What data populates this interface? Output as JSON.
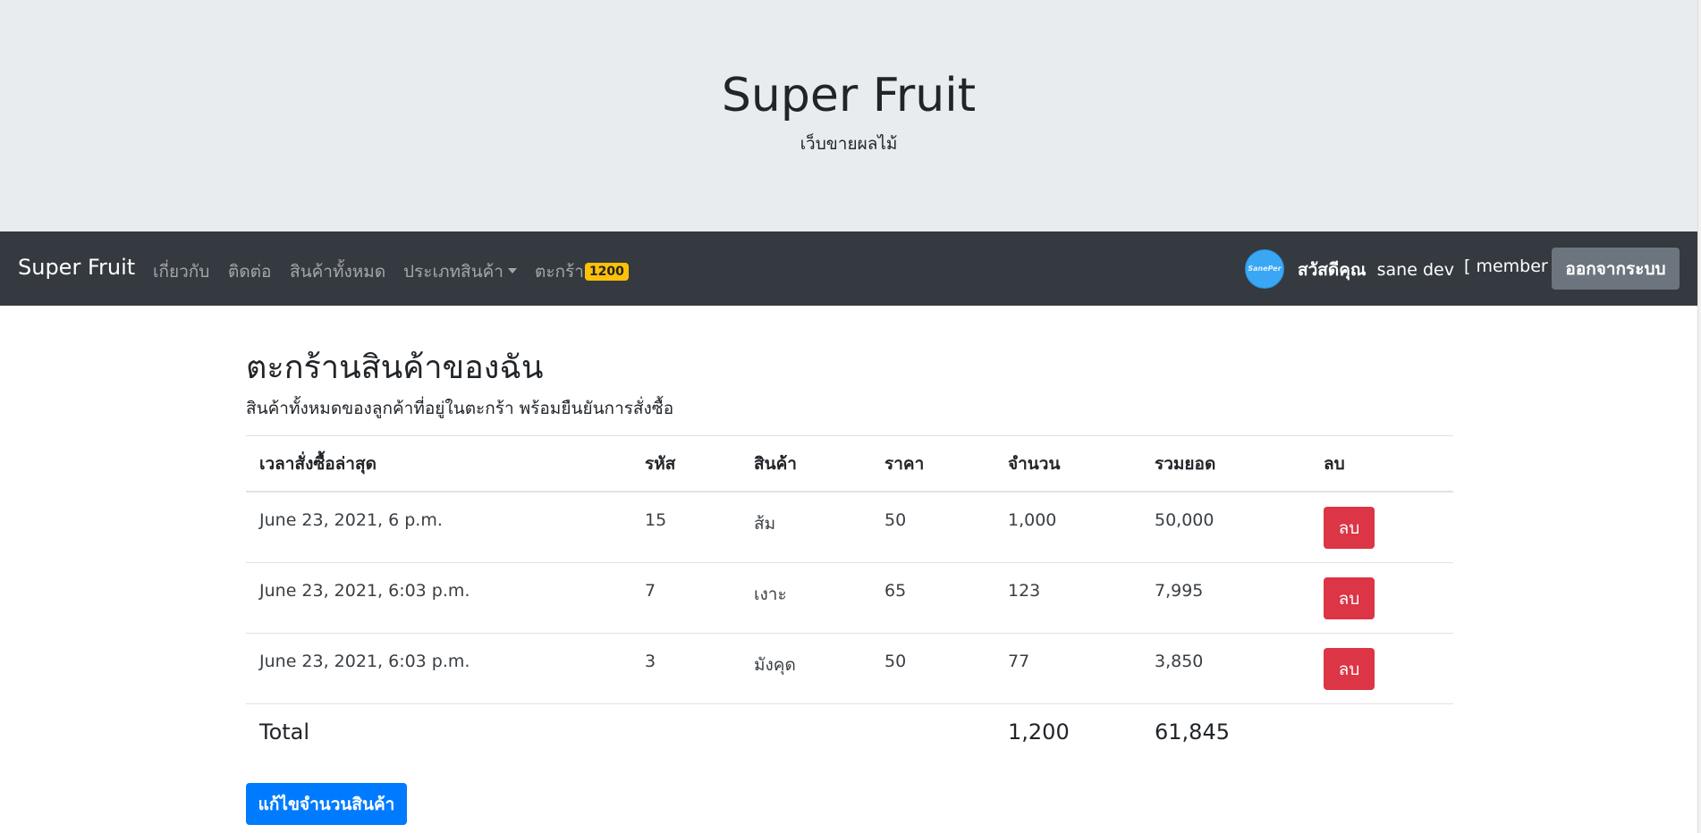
{
  "jumbotron": {
    "title": "Super Fruit",
    "subtitle": "เว็บขายผลไม้"
  },
  "navbar": {
    "brand": "Super Fruit",
    "links": {
      "about": "เกี่ยวกับ",
      "contact": "ติดต่อ",
      "all_products": "สินค้าทั้งหมด",
      "categories": "ประเภทสินค้า",
      "cart": "ตะกร้า"
    },
    "cart_count": "1200",
    "avatar_text": "SanePer",
    "greeting": "สวัสดีคุณ",
    "username": "sane dev",
    "role": "[ member ]",
    "logout_label": "ออกจากระบบ"
  },
  "page": {
    "title": "ตะกร้านสินค้าของฉัน",
    "description": "สินค้าทั้งหมดของลูกค้าที่อยู่ในตะกร้า พร้อมยืนยันการสั่งซื้อ"
  },
  "table": {
    "headers": {
      "time": "เวลาสั่งซื้อล่าสุด",
      "id": "รหัส",
      "product": "สินค้า",
      "price": "ราคา",
      "qty": "จำนวน",
      "sum": "รวมยอด",
      "delete": "ลบ"
    },
    "rows": [
      {
        "time": "June 23, 2021, 6 p.m.",
        "id": "15",
        "product": "ส้ม",
        "price": "50",
        "qty": "1,000",
        "sum": "50,000",
        "delete": "ลบ"
      },
      {
        "time": "June 23, 2021, 6:03 p.m.",
        "id": "7",
        "product": "เงาะ",
        "price": "65",
        "qty": "123",
        "sum": "7,995",
        "delete": "ลบ"
      },
      {
        "time": "June 23, 2021, 6:03 p.m.",
        "id": "3",
        "product": "มังคุด",
        "price": "50",
        "qty": "77",
        "sum": "3,850",
        "delete": "ลบ"
      }
    ],
    "total": {
      "label": "Total",
      "qty": "1,200",
      "sum": "61,845"
    }
  },
  "edit_button_label": "แก้ไขจำนวนสินค้า",
  "colors": {
    "navbar_bg": "#343a40",
    "jumbotron_bg": "#e9ecef",
    "badge": "#ffc107",
    "danger": "#dc3545",
    "primary": "#007bff",
    "secondary": "#6c757d"
  }
}
